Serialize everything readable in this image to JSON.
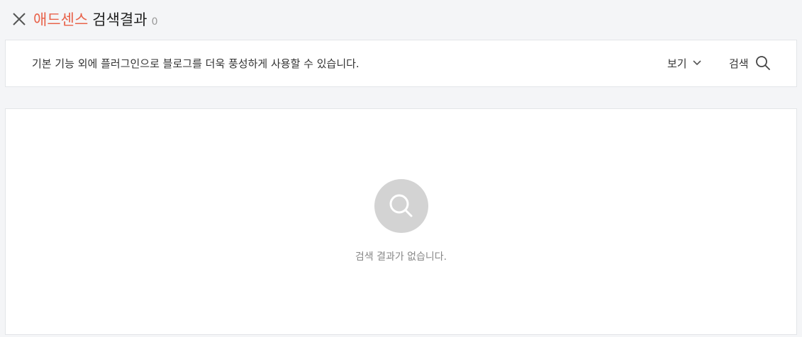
{
  "header": {
    "close_icon": "close-icon",
    "keyword": "애드센스",
    "title_suffix": "검색결과",
    "count": "0",
    "keyword_color": "#e8624a"
  },
  "filter_bar": {
    "description": "기본 기능 외에 플러그인으로 블로그를 더욱 풍성하게 사용할 수 있습니다.",
    "view_label": "보기",
    "view_icon": "chevron-down-icon",
    "search_label": "검색",
    "search_icon": "search-icon"
  },
  "results": {
    "empty_icon": "search-icon",
    "empty_message": "검색 결과가 없습니다."
  }
}
